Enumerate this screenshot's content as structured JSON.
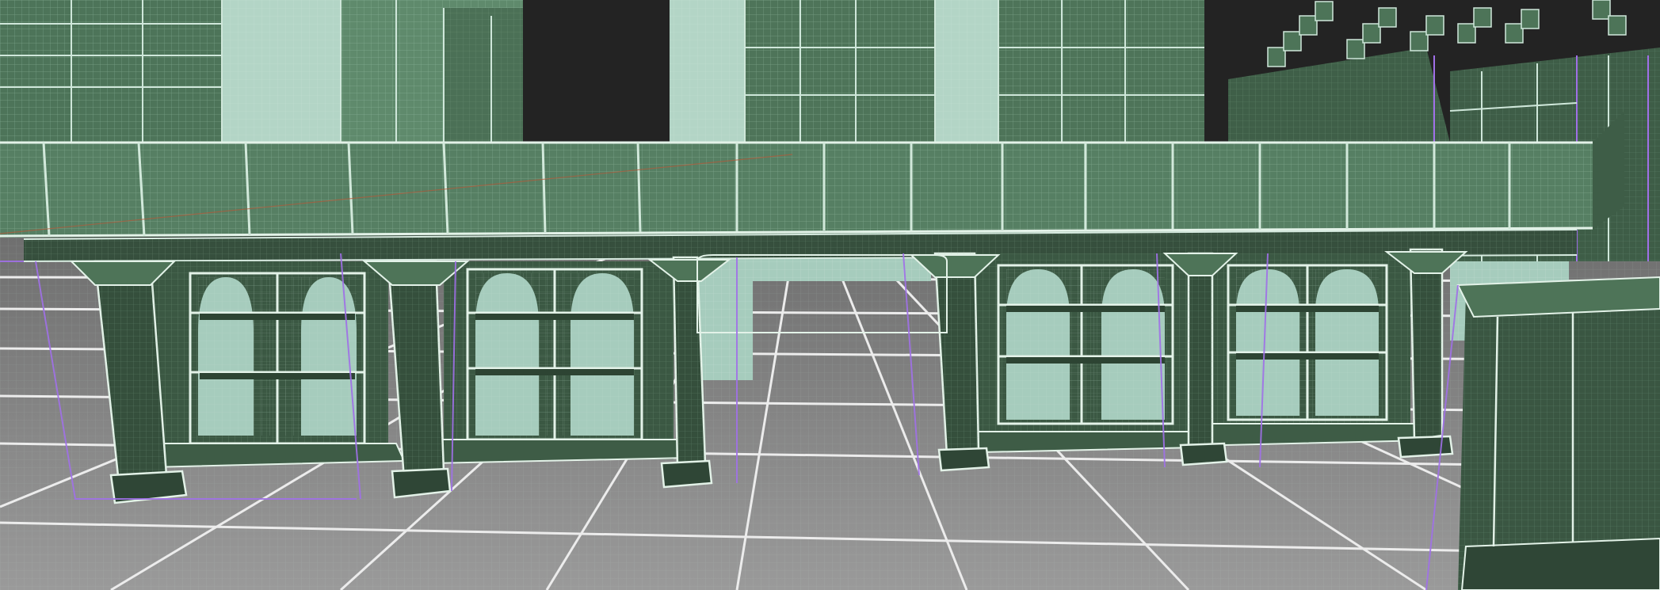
{
  "viewport": {
    "mode": "3d-wireframe-shaded",
    "colors": {
      "background": "#232323",
      "floor": "#8e8e8e",
      "floor_major_line": "#f0f0f0",
      "floor_minor_line": "#a8a8a8",
      "wall_dark": "#3c5a45",
      "wall_mid": "#527a5d",
      "wall_light": "#6e9c7c",
      "glass": "#a6ccbd",
      "edge_line": "#d8ecdf",
      "selection": "#a070e8"
    }
  }
}
